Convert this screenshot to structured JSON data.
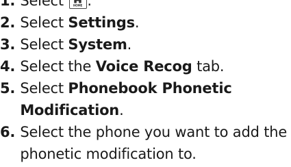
{
  "steps": [
    {
      "number": "1.",
      "text_before": "Select ",
      "icon": "home-icon",
      "icon_label": "HOME",
      "text_after": "."
    },
    {
      "number": "2.",
      "text_before": "Select ",
      "bold": "Settings",
      "text_after": "."
    },
    {
      "number": "3.",
      "text_before": "Select ",
      "bold": "System",
      "text_after": "."
    },
    {
      "number": "4.",
      "text_before": "Select the ",
      "bold": "Voice Recog",
      "text_after": " tab."
    },
    {
      "number": "5.",
      "text_before": "Select ",
      "bold": "Phonebook Phonetic Modification",
      "text_after": "."
    },
    {
      "number": "6.",
      "text_before": "Select the phone you want to add the phonetic modification to."
    }
  ]
}
